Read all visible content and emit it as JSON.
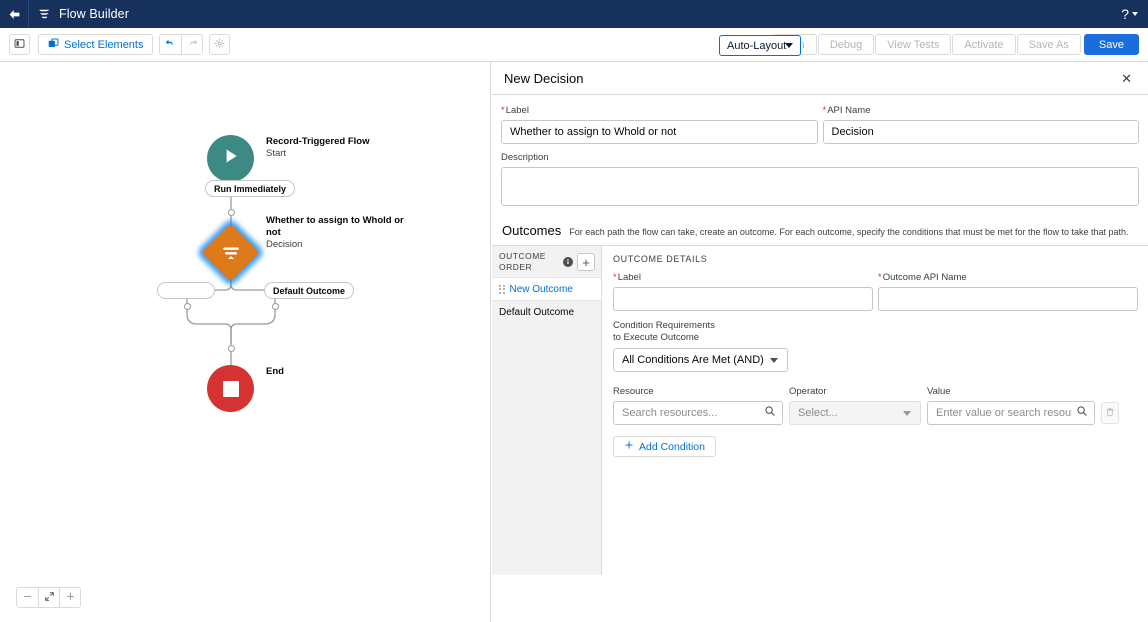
{
  "header": {
    "title": "Flow Builder",
    "back_icon": "arrow-left-icon",
    "logo_icon": "flow-builder-logo-icon",
    "help_icon": "help-question-icon",
    "caret_icon": "chevron-down-icon"
  },
  "toolbar": {
    "panel_toggle_icon": "panel-toggle-icon",
    "select_elements_label": "Select Elements",
    "select_elements_icon": "select-elements-icon",
    "undo_icon": "undo-icon",
    "redo_icon": "redo-icon",
    "settings_icon": "gear-icon",
    "layout_value": "Auto-Layout",
    "buttons": [
      {
        "label": "Run",
        "enabled": false
      },
      {
        "label": "Debug",
        "enabled": false
      },
      {
        "label": "View Tests",
        "enabled": false
      },
      {
        "label": "Activate",
        "enabled": false
      },
      {
        "label": "Save As",
        "enabled": false
      }
    ],
    "save_label": "Save",
    "save_color": "#1b6ddc"
  },
  "canvas": {
    "start": {
      "title": "Record-Triggered Flow",
      "subtitle": "Start",
      "icon": "play-icon",
      "color": "#3d8a84"
    },
    "run_pill": "Run Immediately",
    "decision": {
      "title": "Whether to assign to Whold or not",
      "subtitle": "Decision",
      "icon": "decision-diamond-icon",
      "color": "#dd7a1b",
      "selected_glow": "#1b8bef"
    },
    "outcome_pill_left": "",
    "outcome_pill_right": "Default Outcome",
    "end": {
      "title": "End",
      "icon": "stop-square-icon",
      "color": "#d53232"
    },
    "zoom_controls": {
      "zoom_out_icon": "minus-icon",
      "fit_icon": "fit-to-view-icon",
      "zoom_in_icon": "plus-icon"
    }
  },
  "panel": {
    "title": "New Decision",
    "close_icon": "close-icon",
    "label_field": {
      "label": "Label",
      "required": true,
      "value": "Whether to assign to Whold or not"
    },
    "api_name_field": {
      "label": "API Name",
      "required": true,
      "value": "Decision"
    },
    "description_field": {
      "label": "Description",
      "value": ""
    },
    "outcomes": {
      "title": "Outcomes",
      "help": "For each path the flow can take, create an outcome. For each outcome, specify the conditions that must be met for the flow to take that path.",
      "order_header": "OUTCOME ORDER",
      "info_icon": "info-icon",
      "add_icon": "plus-icon",
      "items": [
        {
          "label": "New Outcome",
          "active": true,
          "drag_icon": "drag-handle-icon"
        },
        {
          "label": "Default Outcome",
          "active": false
        }
      ]
    },
    "details": {
      "title": "OUTCOME DETAILS",
      "label_field": {
        "label": "Label",
        "required": true,
        "value": ""
      },
      "api_name_field": {
        "label": "Outcome API Name",
        "required": true,
        "value": ""
      },
      "condition_requirements_label": "Condition Requirements to Execute Outcome",
      "condition_requirements_value": "All Conditions Are Met (AND)",
      "condition_row": {
        "resource_label": "Resource",
        "resource_placeholder": "Search resources...",
        "resource_icon": "search-icon",
        "operator_label": "Operator",
        "operator_value": "Select...",
        "operator_disabled": true,
        "value_label": "Value",
        "value_placeholder": "Enter value or search resources...",
        "value_icon": "search-icon",
        "delete_icon": "trash-icon"
      },
      "add_condition_label": "Add Condition",
      "add_condition_icon": "plus-icon"
    }
  }
}
